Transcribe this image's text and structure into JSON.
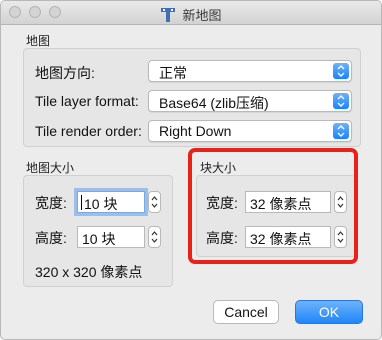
{
  "window": {
    "title": "新地图"
  },
  "map_group": {
    "label": "地图",
    "orientation": {
      "label": "地图方向:",
      "value": "正常"
    },
    "format": {
      "label": "Tile layer format:",
      "value": "Base64 (zlib压缩)"
    },
    "render_order": {
      "label": "Tile render order:",
      "value": "Right Down"
    }
  },
  "map_size": {
    "label": "地图大小",
    "width": {
      "label": "宽度:",
      "value": "10 块"
    },
    "height": {
      "label": "高度:",
      "value": "10 块"
    },
    "pixel_info": "320 x 320 像素点"
  },
  "tile_size": {
    "label": "块大小",
    "width": {
      "label": "宽度:",
      "value": "32 像素点"
    },
    "height": {
      "label": "高度:",
      "value": "32 像素点"
    }
  },
  "buttons": {
    "cancel": "Cancel",
    "ok": "OK"
  },
  "colors": {
    "accent": "#1a82fb",
    "highlight": "#e8221b"
  }
}
